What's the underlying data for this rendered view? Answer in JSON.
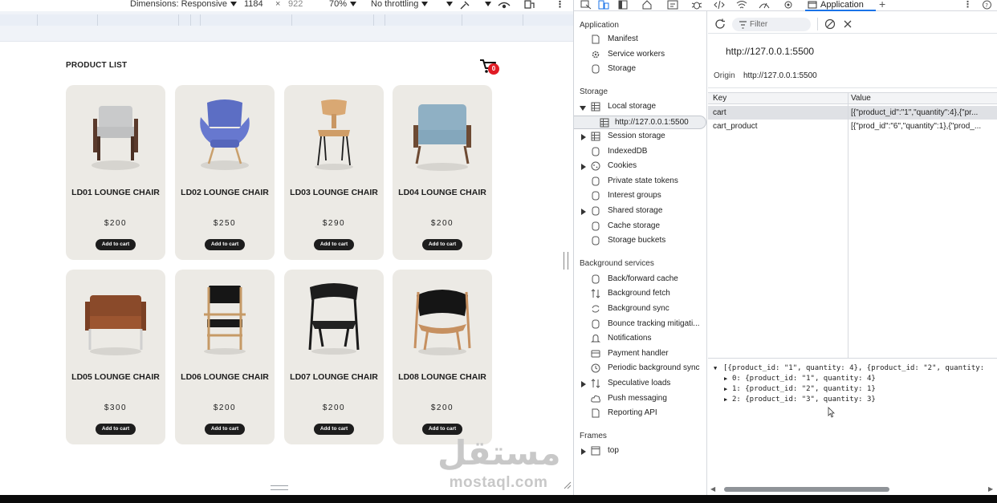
{
  "device_toolbar": {
    "dimensions_label": "Dimensions: Responsive",
    "width": "1184",
    "times": "×",
    "height": "922",
    "zoom": "70%",
    "throttling": "No throttling"
  },
  "page": {
    "title": "PRODUCT LIST",
    "cart_count": "0",
    "add_label": "Add to cart",
    "products": [
      {
        "name": "LD01 LOUNGE CHAIR",
        "price": "$200"
      },
      {
        "name": "LD02 LOUNGE CHAIR",
        "price": "$250"
      },
      {
        "name": "LD03 LOUNGE CHAIR",
        "price": "$290"
      },
      {
        "name": "LD04 LOUNGE CHAIR",
        "price": "$200"
      },
      {
        "name": "LD05 LOUNGE CHAIR",
        "price": "$300"
      },
      {
        "name": "LD06 LOUNGE CHAIR",
        "price": "$200"
      },
      {
        "name": "LD07 LOUNGE CHAIR",
        "price": "$200"
      },
      {
        "name": "LD08 LOUNGE CHAIR",
        "price": "$200"
      }
    ]
  },
  "watermark": {
    "arabic": "مستقل",
    "latin": "mostaql.com"
  },
  "devtools": {
    "active_tab": "Application",
    "sidebar": {
      "application_header": "Application",
      "application_items": [
        "Manifest",
        "Service workers",
        "Storage"
      ],
      "storage_header": "Storage",
      "local_storage": "Local storage",
      "local_origin": "http://127.0.0.1:5500",
      "storage_items": [
        "Session storage",
        "IndexedDB",
        "Cookies",
        "Private state tokens",
        "Interest groups",
        "Shared storage",
        "Cache storage",
        "Storage buckets"
      ],
      "background_header": "Background services",
      "background_items": [
        "Back/forward cache",
        "Background fetch",
        "Background sync",
        "Bounce tracking mitigati...",
        "Notifications",
        "Payment handler",
        "Periodic background sync",
        "Speculative loads",
        "Push messaging",
        "Reporting API"
      ],
      "frames_header": "Frames",
      "frames_items": [
        "top"
      ]
    },
    "main": {
      "filter_placeholder": "Filter",
      "origin_title": "http://127.0.0.1:5500",
      "origin_label": "Origin",
      "origin_value": "http://127.0.0.1:5500",
      "table": {
        "key_header": "Key",
        "value_header": "Value",
        "rows": [
          {
            "key": "cart",
            "value": "[{\"product_id\":\"1\",\"quantity\":4},{\"pr..."
          },
          {
            "key": "cart_product",
            "value": "[{\"prod_id\":\"6\",\"quantity\":1},{\"prod_..."
          }
        ]
      },
      "preview": [
        "[{product_id: \"1\", quantity: 4}, {product_id: \"2\", quantity:",
        "0: {product_id: \"1\", quantity: 4}",
        "1: {product_id: \"2\", quantity: 1}",
        "2: {product_id: \"3\", quantity: 3}"
      ]
    }
  }
}
